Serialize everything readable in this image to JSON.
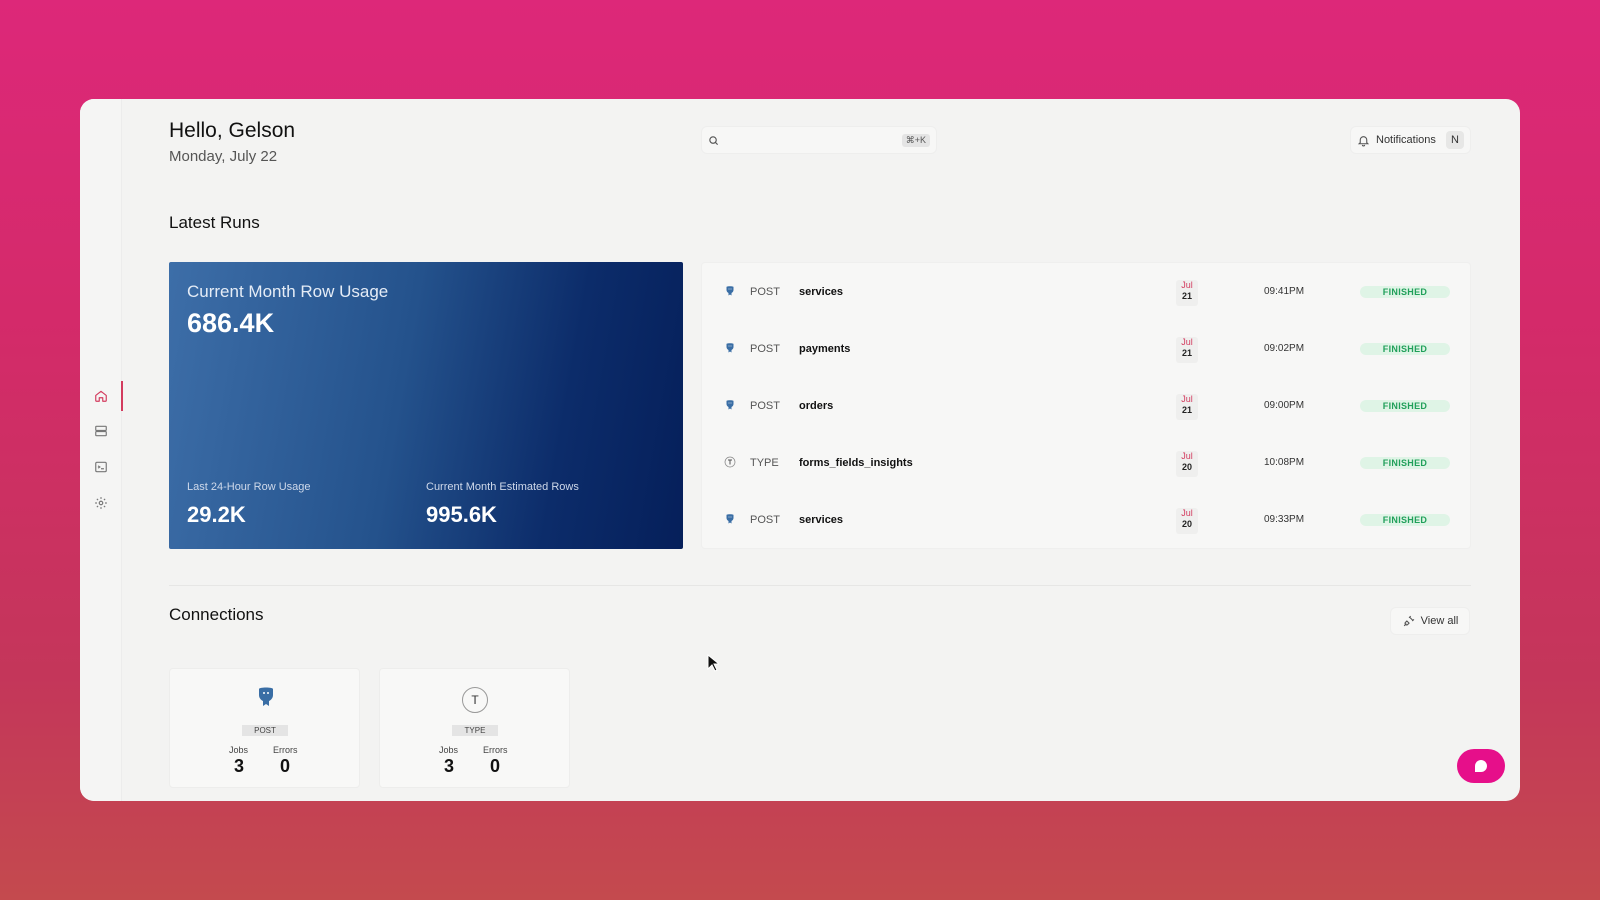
{
  "header": {
    "greeting": "Hello, Gelson",
    "date": "Monday, July 22",
    "search_shortcut": "⌘+K",
    "notifications_label": "Notifications",
    "avatar_initial": "N"
  },
  "sidebar": {
    "items": [
      {
        "icon": "home-icon",
        "active": true
      },
      {
        "icon": "database-icon",
        "active": false
      },
      {
        "icon": "terminal-icon",
        "active": false
      },
      {
        "icon": "gear-icon",
        "active": false
      }
    ]
  },
  "latest_runs": {
    "title": "Latest Runs",
    "usage": {
      "title": "Current Month Row Usage",
      "value": "686.4K",
      "last24_label": "Last 24-Hour Row Usage",
      "last24_value": "29.2K",
      "estimated_label": "Current Month Estimated Rows",
      "estimated_value": "995.6K"
    },
    "runs": [
      {
        "icon": "postgres-icon",
        "type": "POST",
        "name": "services",
        "month": "Jul",
        "day": "21",
        "time": "09:41PM",
        "status": "FINISHED"
      },
      {
        "icon": "postgres-icon",
        "type": "POST",
        "name": "payments",
        "month": "Jul",
        "day": "21",
        "time": "09:02PM",
        "status": "FINISHED"
      },
      {
        "icon": "postgres-icon",
        "type": "POST",
        "name": "orders",
        "month": "Jul",
        "day": "21",
        "time": "09:00PM",
        "status": "FINISHED"
      },
      {
        "icon": "typeform-icon",
        "type": "TYPE",
        "name": "forms_fields_insights",
        "month": "Jul",
        "day": "20",
        "time": "10:08PM",
        "status": "FINISHED"
      },
      {
        "icon": "postgres-icon",
        "type": "POST",
        "name": "services",
        "month": "Jul",
        "day": "20",
        "time": "09:33PM",
        "status": "FINISHED"
      }
    ]
  },
  "connections": {
    "title": "Connections",
    "view_all_label": "View all",
    "items": [
      {
        "icon": "postgres-icon",
        "badge": "POST",
        "jobs_label": "Jobs",
        "jobs": "3",
        "errors_label": "Errors",
        "errors": "0"
      },
      {
        "icon": "typeform-icon",
        "icon_letter": "T",
        "badge": "TYPE",
        "jobs_label": "Jobs",
        "jobs": "3",
        "errors_label": "Errors",
        "errors": "0"
      }
    ]
  },
  "colors": {
    "accent": "#d33b5e",
    "status_green": "#21a05a",
    "chat_button": "#e60f8a",
    "card_blue_dark": "#051f5a",
    "card_blue_light": "#3d6ea8"
  }
}
